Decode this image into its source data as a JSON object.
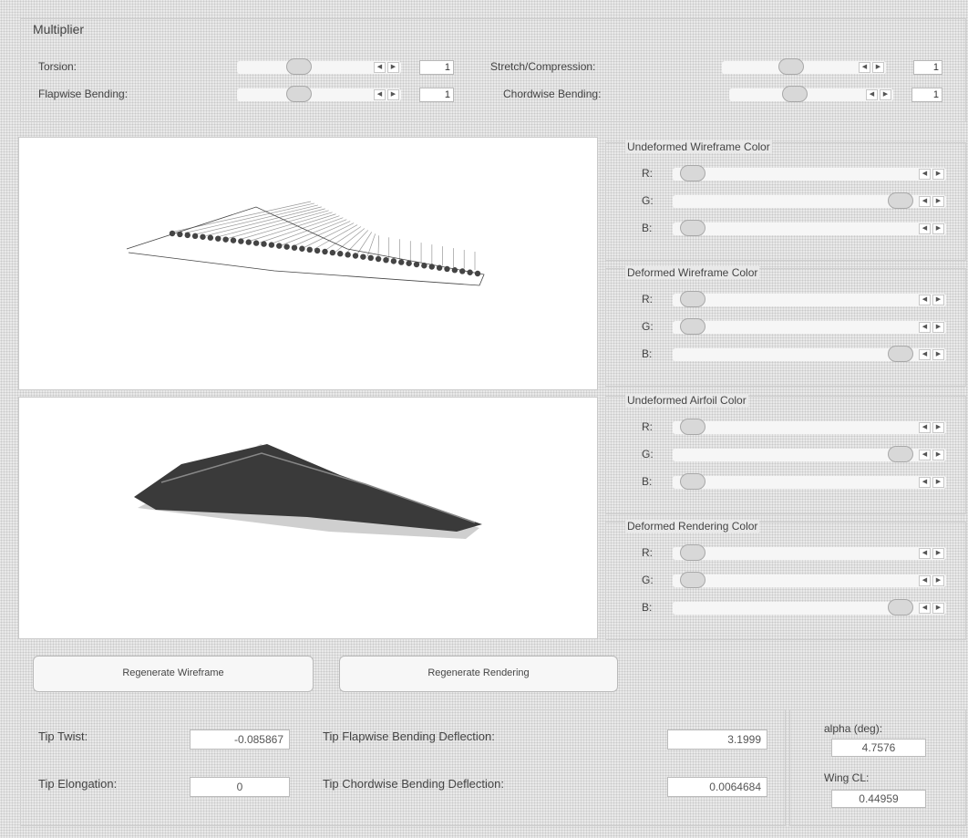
{
  "multiplier": {
    "title": "Multiplier",
    "torsion": {
      "label": "Torsion:",
      "value": "1"
    },
    "stretch": {
      "label": "Stretch/Compression:",
      "value": "1"
    },
    "flapwise": {
      "label": "Flapwise Bending:",
      "value": "1"
    },
    "chordwise": {
      "label": "Chordwise Bending:",
      "value": "1"
    }
  },
  "color_groups": [
    {
      "title": "Undeformed Wireframe Color",
      "channels": [
        {
          "label": "R:",
          "level": 0.0
        },
        {
          "label": "G:",
          "level": 1.0
        },
        {
          "label": "B:",
          "level": 0.0
        }
      ]
    },
    {
      "title": "Deformed Wireframe Color",
      "channels": [
        {
          "label": "R:",
          "level": 0.0
        },
        {
          "label": "G:",
          "level": 0.0
        },
        {
          "label": "B:",
          "level": 1.0
        }
      ]
    },
    {
      "title": "Undeformed Airfoil Color",
      "channels": [
        {
          "label": "R:",
          "level": 0.0
        },
        {
          "label": "G:",
          "level": 1.0
        },
        {
          "label": "B:",
          "level": 0.0
        }
      ]
    },
    {
      "title": "Deformed Rendering Color",
      "channels": [
        {
          "label": "R:",
          "level": 0.0
        },
        {
          "label": "G:",
          "level": 0.0
        },
        {
          "label": "B:",
          "level": 1.0
        }
      ]
    }
  ],
  "buttons": {
    "regen_wireframe": "Regenerate Wireframe",
    "regen_rendering": "Regenerate Rendering"
  },
  "results": {
    "tip_twist": {
      "label": "Tip Twist:",
      "value": "-0.085867"
    },
    "tip_elongation": {
      "label": "Tip Elongation:",
      "value": "0"
    },
    "tip_flapwise": {
      "label": "Tip Flapwise Bending Deflection:",
      "value": "3.1999"
    },
    "tip_chordwise": {
      "label": "Tip Chordwise Bending Deflection:",
      "value": "0.0064684"
    },
    "alpha": {
      "label": "alpha (deg):",
      "value": "4.7576"
    },
    "wing_cl": {
      "label": "Wing CL:",
      "value": "0.44959"
    }
  },
  "colors": {
    "wire_dark": "#444444",
    "wire_light": "#999999",
    "surface": "#333333"
  }
}
